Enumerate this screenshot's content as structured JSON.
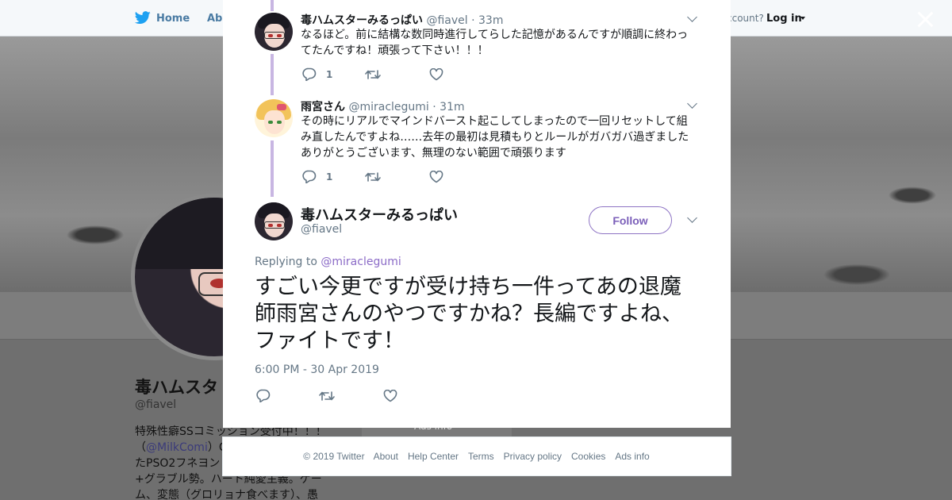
{
  "nav": {
    "home": "Home",
    "about": "Abo",
    "account_prompt": "ccount?",
    "login": "Log in"
  },
  "profile_bg": {
    "name": "毒ハムスタ",
    "handle": "@fiavel",
    "bio_line1": "特殊性癖SSコミッション受付中！！！",
    "bio_line2_pre": "（",
    "bio_link": "@MilkComi",
    "bio_line2_post": "）C",
    "bio_line3": "たPSO2フネヨン",
    "bio_line4": "+グラブル勢。ハート純愛主義。ゲー",
    "bio_line5": "ム、変態（グロリョナ食べます）、愚",
    "side_box": "Ads info"
  },
  "thread": [
    {
      "name": "毒ハムスターみるっぱい",
      "handle": "@fiavel",
      "dot": " · ",
      "time": "33m",
      "text_line1": "なるほど。前に結構な数同時進行してらした記憶があるんですが順調に終わっ",
      "text_line2": "てたんですね！頑張って下さい！！！",
      "reply_count": "1"
    },
    {
      "name": "雨宮さん",
      "handle": "@miraclegumi",
      "dot": " · ",
      "time": "31m",
      "text_line1": "その時にリアルでマインドバースト起こしてしまったので一回リセットして組",
      "text_line2": "み直したんですよね……去年の最初は見積もりとルールがガバガバ過ぎました",
      "text_line3": "ありがとうございます、無理のない範囲で頑張ります",
      "reply_count": "1"
    }
  ],
  "main_tweet": {
    "name": "毒ハムスターみるっぱい",
    "handle": "@fiavel",
    "follow_label": "Follow",
    "replying_prefix": "Replying to ",
    "replying_to": "@miraclegumi",
    "text_line1": "すごい今更ですが受け持ち一件ってあの退魔",
    "text_line2": "師雨宮さんのやつですかね？長編ですよね、",
    "text_line3": "ファイトです！",
    "timestamp": "6:00 PM - 30 Apr 2019"
  },
  "footer": {
    "copyright": "© 2019 Twitter",
    "links": [
      "About",
      "Help Center",
      "Terms",
      "Privacy policy",
      "Cookies",
      "Ads info"
    ]
  },
  "colors": {
    "accent": "#8b6bc7",
    "thread_line": "#c8b6e2",
    "muted": "#657786"
  }
}
